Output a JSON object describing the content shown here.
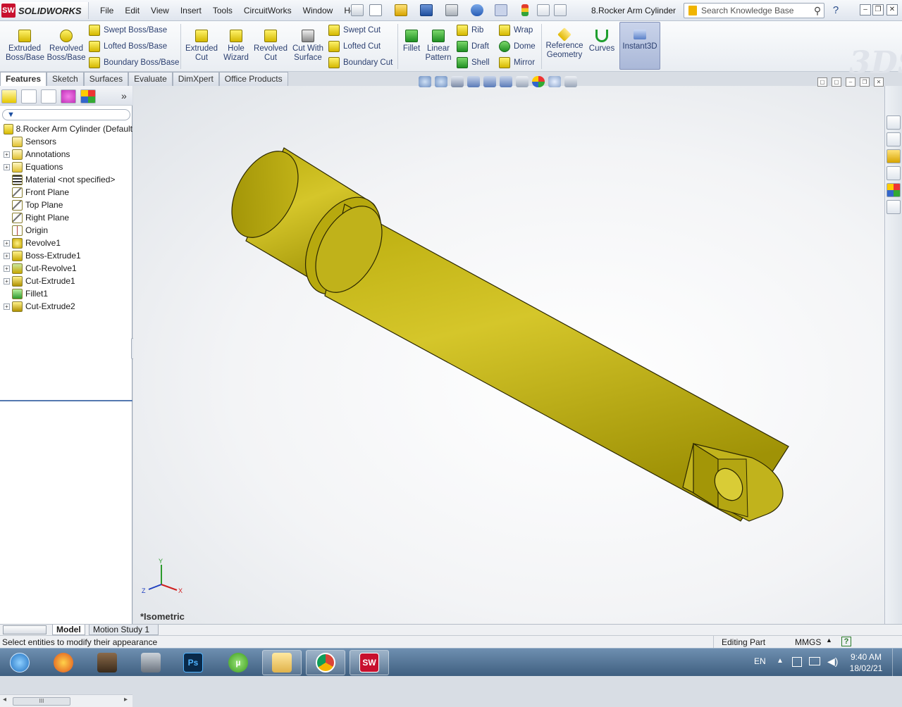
{
  "app": {
    "name": "SOLIDWORKS",
    "logo_text": "SW",
    "document_title": "8.Rocker Arm Cylinder"
  },
  "menu": [
    "File",
    "Edit",
    "View",
    "Insert",
    "Tools",
    "CircuitWorks",
    "Window",
    "Help"
  ],
  "search": {
    "placeholder": "Search Knowledge Base"
  },
  "ribbon": {
    "extruded_boss": "Extruded\nBoss/Base",
    "revolved_boss": "Revolved\nBoss/Base",
    "swept_boss": "Swept Boss/Base",
    "lofted_boss": "Lofted Boss/Base",
    "boundary_boss": "Boundary Boss/Base",
    "extruded_cut": "Extruded\nCut",
    "hole_wizard": "Hole\nWizard",
    "revolved_cut": "Revolved\nCut",
    "cut_with_surface": "Cut With\nSurface",
    "swept_cut": "Swept Cut",
    "lofted_cut": "Lofted Cut",
    "boundary_cut": "Boundary Cut",
    "fillet": "Fillet",
    "linear_pattern": "Linear\nPattern",
    "rib": "Rib",
    "draft": "Draft",
    "shell": "Shell",
    "wrap": "Wrap",
    "dome": "Dome",
    "mirror": "Mirror",
    "reference_geometry": "Reference\nGeometry",
    "curves": "Curves",
    "instant3d": "Instant3D"
  },
  "tabs": [
    "Features",
    "Sketch",
    "Surfaces",
    "Evaluate",
    "DimXpert",
    "Office Products"
  ],
  "tree": [
    {
      "label": "8.Rocker Arm Cylinder  (Default",
      "icon": "part-icon",
      "expand": false,
      "root": true
    },
    {
      "label": "Sensors",
      "icon": "sensor-icon",
      "expand": false
    },
    {
      "label": "Annotations",
      "icon": "annotation-icon",
      "expand": true
    },
    {
      "label": "Equations",
      "icon": "equation-icon",
      "expand": true
    },
    {
      "label": "Material <not specified>",
      "icon": "material-icon",
      "expand": false
    },
    {
      "label": "Front Plane",
      "icon": "plane-icon",
      "expand": false
    },
    {
      "label": "Top Plane",
      "icon": "plane-icon",
      "expand": false
    },
    {
      "label": "Right Plane",
      "icon": "plane-icon",
      "expand": false
    },
    {
      "label": "Origin",
      "icon": "origin-icon",
      "expand": false
    },
    {
      "label": "Revolve1",
      "icon": "revolve-icon",
      "expand": true
    },
    {
      "label": "Boss-Extrude1",
      "icon": "extrude-icon",
      "expand": true
    },
    {
      "label": "Cut-Revolve1",
      "icon": "cut-revolve-icon",
      "expand": true
    },
    {
      "label": "Cut-Extrude1",
      "icon": "cut-extrude-icon",
      "expand": true
    },
    {
      "label": "Fillet1",
      "icon": "fillet-icon",
      "expand": false
    },
    {
      "label": "Cut-Extrude2",
      "icon": "cut-extrude-icon",
      "expand": true
    }
  ],
  "viewport": {
    "view_label": "*Isometric",
    "triad": {
      "x": "X",
      "y": "Y",
      "z": "Z"
    },
    "part_color": "#c8bb10"
  },
  "bottom_tabs": {
    "model": "Model",
    "motion": "Motion Study 1"
  },
  "status": {
    "message": "Select entities to modify their appearance",
    "mode": "Editing Part",
    "units": "MMGS"
  },
  "taskbar": {
    "apps": [
      "start",
      "firefox",
      "game",
      "counter-strike",
      "photoshop",
      "utorrent",
      "file-explorer",
      "chrome",
      "solidworks"
    ],
    "lang": "EN",
    "time": "9:40 AM",
    "date": "18/02/21"
  },
  "colors": {
    "accent": "#c8102e",
    "part": "#c8bb10",
    "instant3d_active": "#aab8d8"
  }
}
